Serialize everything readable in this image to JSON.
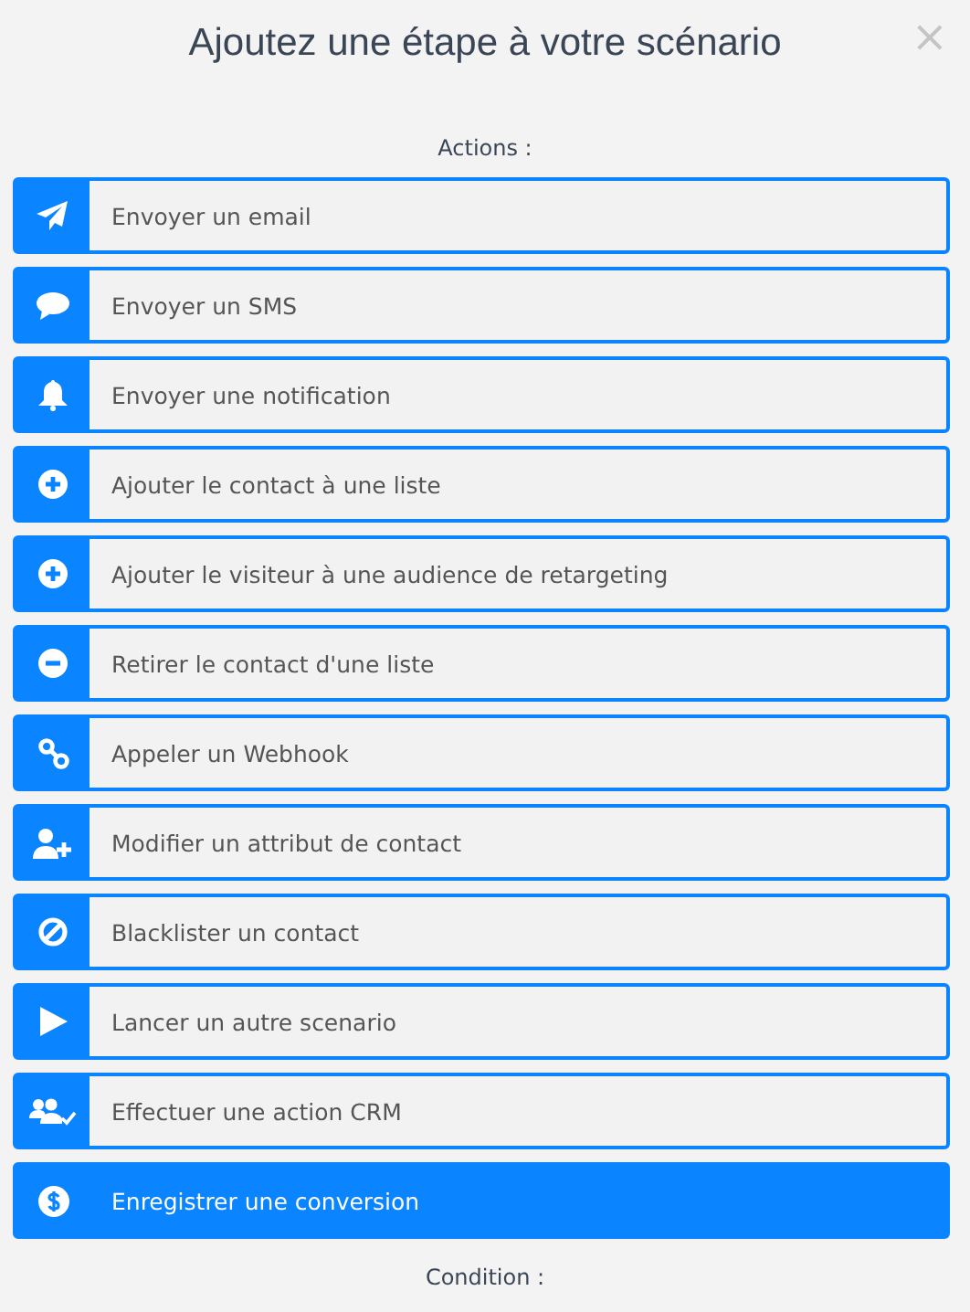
{
  "dialog": {
    "title": "Ajoutez une étape à votre scénario",
    "close": "×"
  },
  "actions_heading": "Actions :",
  "actions": [
    {
      "label": "Envoyer un email",
      "kind": "send",
      "selected": false
    },
    {
      "label": "Envoyer un SMS",
      "kind": "chat",
      "selected": false
    },
    {
      "label": "Envoyer une notification",
      "kind": "bell",
      "selected": false
    },
    {
      "label": "Ajouter le contact à une liste",
      "kind": "plus",
      "selected": false
    },
    {
      "label": "Ajouter le visiteur à une audience de retargeting",
      "kind": "plus",
      "selected": false
    },
    {
      "label": "Retirer le contact d'une liste",
      "kind": "minus",
      "selected": false
    },
    {
      "label": "Appeler un Webhook",
      "kind": "link",
      "selected": false
    },
    {
      "label": "Modifier un attribut de contact",
      "kind": "userplus",
      "selected": false
    },
    {
      "label": "Blacklister un contact",
      "kind": "ban",
      "selected": false
    },
    {
      "label": "Lancer un autre scenario",
      "kind": "play",
      "selected": false
    },
    {
      "label": "Effectuer une action CRM",
      "kind": "crm",
      "selected": false
    },
    {
      "label": "Enregistrer une conversion",
      "kind": "conversion",
      "selected": true
    }
  ],
  "condition_heading": "Condition :"
}
